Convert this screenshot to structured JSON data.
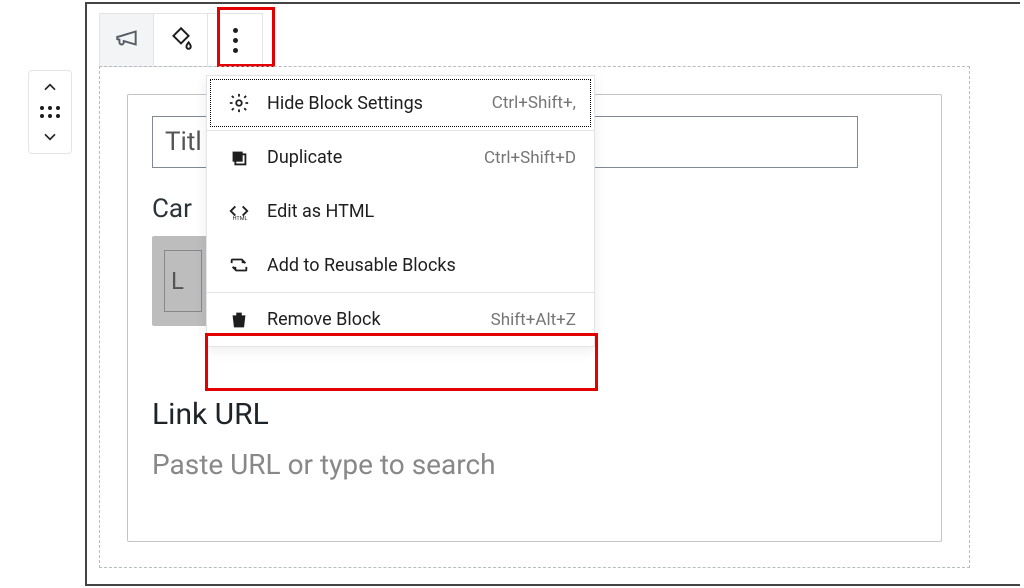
{
  "title_input": {
    "value": "Titl"
  },
  "labels": {
    "card_background": "Car",
    "swatch_letter": "L",
    "link_url": "Link URL"
  },
  "link_input": {
    "placeholder": "Paste URL or type to search"
  },
  "menu": {
    "hide_settings": {
      "label": "Hide Block Settings",
      "shortcut": "Ctrl+Shift+,"
    },
    "duplicate": {
      "label": "Duplicate",
      "shortcut": "Ctrl+Shift+D"
    },
    "edit_html": {
      "label": "Edit as HTML"
    },
    "reusable": {
      "label": "Add to Reusable Blocks"
    },
    "remove": {
      "label": "Remove Block",
      "shortcut": "Shift+Alt+Z"
    }
  }
}
